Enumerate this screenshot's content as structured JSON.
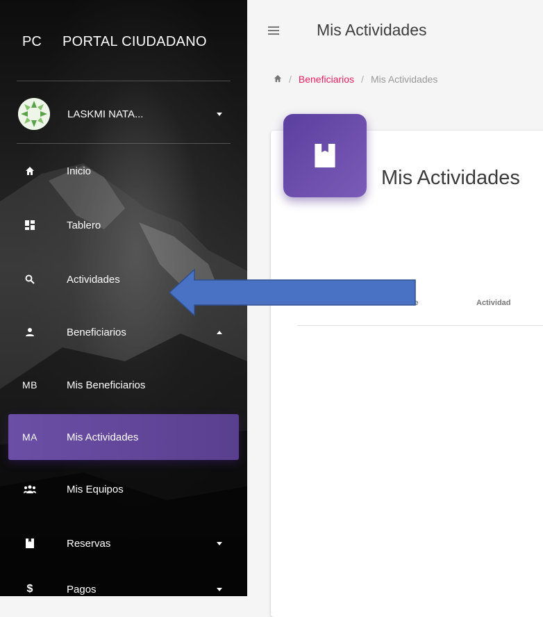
{
  "brand": {
    "mini": "PC",
    "full": "PORTAL CIUDADANO"
  },
  "user": {
    "name": "LASKMI NATA..."
  },
  "sidebar": {
    "items": [
      {
        "label": "Inicio",
        "icon": "home-icon",
        "glyph": ""
      },
      {
        "label": "Tablero",
        "icon": "dashboard-icon",
        "glyph": ""
      },
      {
        "label": "Actividades",
        "icon": "search-icon",
        "glyph": ""
      },
      {
        "label": "Beneficiarios",
        "icon": "person-icon",
        "glyph": ""
      },
      {
        "label": "Mis Beneficiarios",
        "icon": "",
        "glyph": "MB"
      },
      {
        "label": "Mis Actividades",
        "icon": "",
        "glyph": "MA",
        "active": true
      },
      {
        "label": "Mis Equipos",
        "icon": "group-icon",
        "glyph": ""
      },
      {
        "label": "Reservas",
        "icon": "bookmark-icon",
        "glyph": ""
      },
      {
        "label": "Pagos",
        "icon": "dollar-icon",
        "glyph": "$"
      }
    ]
  },
  "header": {
    "title": "Mis Actividades"
  },
  "breadcrumb": {
    "link": "Beneficiarios",
    "current": "Mis Actividades"
  },
  "card": {
    "title": "Mis Actividades",
    "columns": [
      "#",
      "Nombre",
      "Actividad"
    ]
  },
  "colors": {
    "accent": "#6b4fa6",
    "breadcrumb_link": "#e91e63",
    "arrow": "#4a72c4"
  }
}
